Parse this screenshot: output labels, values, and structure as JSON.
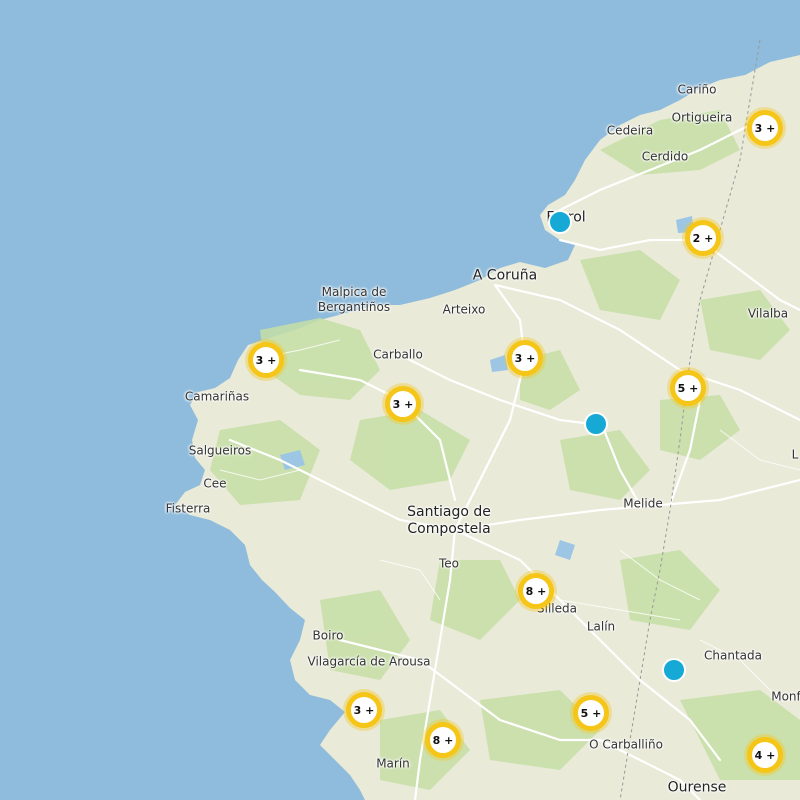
{
  "map": {
    "colors": {
      "sea": "#8fbcdc",
      "land": "#e9ead8",
      "vegetation": "#c6dfa6",
      "roads": "#ffffff",
      "cluster_ring": "#f5c518",
      "point": "#16a9d6"
    },
    "places": {
      "carino": "Cariño",
      "ortigueira": "Ortigueira",
      "cedeira": "Cedeira",
      "cerdido": "Cerdido",
      "ferrol": "Ferrol",
      "acoruna": "A Coruña",
      "malpica": "Malpica de\nBergantiños",
      "arteixo": "Arteixo",
      "vilalba": "Vilalba",
      "carballo": "Carballo",
      "camarinas": "Camariñas",
      "salgueiros": "Salgueiros",
      "cee": "Cee",
      "fisterra": "Fisterra",
      "melide": "Melide",
      "santiago": "Santiago de\nCompostela",
      "teo": "Teo",
      "silleda": "Silleda",
      "lalin": "Lalín",
      "chantada": "Chantada",
      "boiro": "Boiro",
      "vilagarcia": "Vilagarcía de Arousa",
      "ocarballino": "O Carballiño",
      "monforte": "Monf",
      "marin": "Marín",
      "ourense": "Ourense",
      "lugo_partial": "L"
    },
    "clusters": [
      {
        "id": "c1",
        "label": "3 +"
      },
      {
        "id": "c2",
        "label": "2 +"
      },
      {
        "id": "c3",
        "label": "3 +"
      },
      {
        "id": "c4",
        "label": "3 +"
      },
      {
        "id": "c5",
        "label": "5 +"
      },
      {
        "id": "c6",
        "label": "3 +"
      },
      {
        "id": "c7",
        "label": "8 +"
      },
      {
        "id": "c8",
        "label": "3 +"
      },
      {
        "id": "c9",
        "label": "8 +"
      },
      {
        "id": "c10",
        "label": "5 +"
      },
      {
        "id": "c11",
        "label": "4 +"
      }
    ]
  }
}
